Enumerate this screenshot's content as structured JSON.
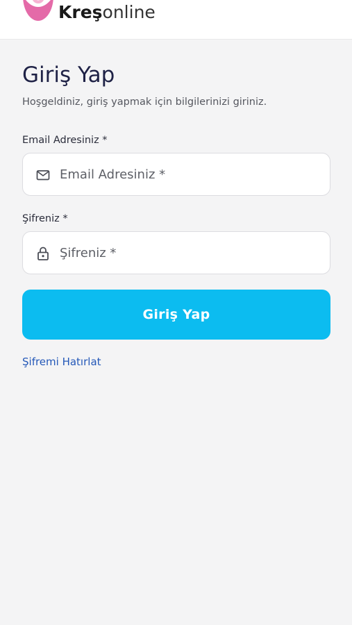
{
  "header": {
    "logo_bold": "Kreş",
    "logo_light": "online"
  },
  "login": {
    "title": "Giriş Yap",
    "subtitle": "Hoşgeldiniz, giriş yapmak için bilgilerinizi giriniz.",
    "email": {
      "label": "Email Adresiniz *",
      "placeholder": "Email Adresiniz *",
      "value": ""
    },
    "password": {
      "label": "Şifreniz *",
      "placeholder": "Şifreniz *",
      "value": ""
    },
    "submit_label": "Giriş Yap",
    "forgot_label": "Şifremi Hatırlat"
  },
  "colors": {
    "accent": "#0cbcf0",
    "title": "#1f2246",
    "link": "#2458b8",
    "background": "#f4f4f5",
    "logo_pink": "#e46aa8"
  },
  "icons": {
    "logo": "kresonline-logo-icon",
    "email": "mail-icon",
    "password": "lock-icon"
  }
}
